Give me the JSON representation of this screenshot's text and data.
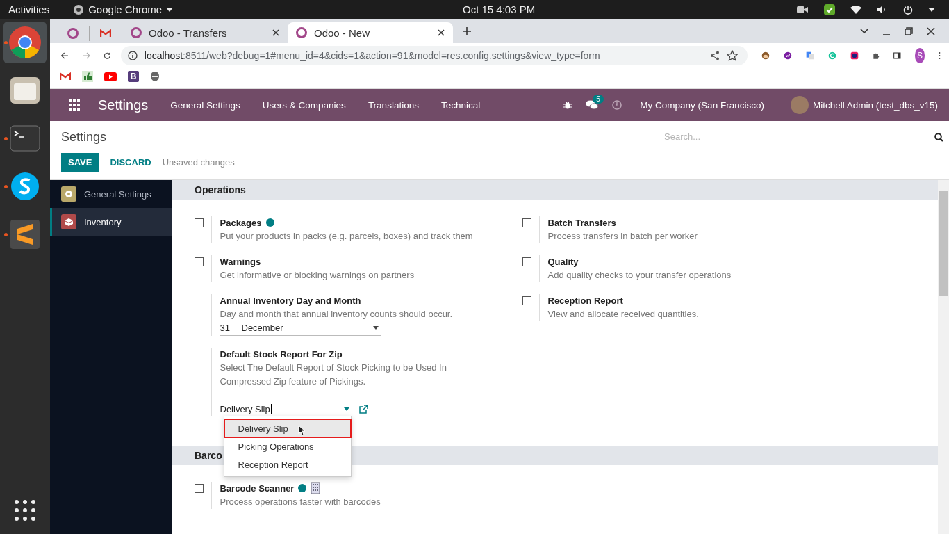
{
  "topbar": {
    "activities": "Activities",
    "app_name": "Google Chrome",
    "clock": "Oct 15  4:03 PM"
  },
  "dock": [
    {
      "kind": "browser",
      "running": true,
      "selected": true
    },
    {
      "kind": "files",
      "running": false,
      "selected": false
    },
    {
      "kind": "terminal",
      "running": true,
      "selected": false
    },
    {
      "kind": "chat",
      "running": true,
      "selected": false
    },
    {
      "kind": "editor",
      "running": true,
      "selected": false
    }
  ],
  "browser": {
    "tabs": [
      {
        "kind": "pinned-odoo",
        "selected": false
      },
      {
        "kind": "pinned-mail",
        "selected": false
      },
      {
        "kind": "odoo",
        "title": "Odoo - Transfers",
        "selected": false
      },
      {
        "kind": "odoo",
        "title": "Odoo - New",
        "selected": true
      }
    ],
    "url_host": "localhost",
    "url_rest": ":8511/web?debug=1#menu_id=4&cids=1&action=91&model=res.config.settings&view_type=form",
    "profile": "S",
    "bookmarks": [
      {
        "kind": "mail"
      },
      {
        "kind": "thumb"
      },
      {
        "kind": "video"
      },
      {
        "kind": "letter",
        "label": "B"
      },
      {
        "kind": "mask"
      }
    ]
  },
  "navbar": {
    "app": "Settings",
    "menu": [
      "General Settings",
      "Users & Companies",
      "Translations",
      "Technical"
    ],
    "messages_badge": "5",
    "company": "My Company (San Francisco)",
    "user": "Mitchell Admin (test_dbs_v15)"
  },
  "control_panel": {
    "title": "Settings",
    "save": "SAVE",
    "discard": "DISCARD",
    "status": "Unsaved changes",
    "search_placeholder": "Search..."
  },
  "sidebar": [
    {
      "kind": "general",
      "label": "General Settings",
      "selected": false
    },
    {
      "kind": "inventory",
      "label": "Inventory",
      "selected": true
    }
  ],
  "operations": {
    "title": "Operations",
    "left": [
      {
        "kind": "checkbox",
        "title": "Packages",
        "help": true,
        "checked": false,
        "description": "Put your products in packs (e.g. parcels, boxes) and track them"
      },
      {
        "kind": "checkbox",
        "title": "Warnings",
        "help": false,
        "checked": false,
        "description": "Get informative or blocking warnings on partners"
      },
      {
        "kind": "date",
        "title": "Annual Inventory Day and Month",
        "description": "Day and month that annual inventory counts should occur.",
        "day": "31",
        "month": "December"
      },
      {
        "kind": "select",
        "title": "Default Stock Report For Zip",
        "description": "Select The Default Report of Stock Picking to be Used In Compressed Zip feature of Pickings.",
        "value": "Delivery Slip",
        "options": [
          {
            "label": "Delivery Slip",
            "selected": true
          },
          {
            "label": "Picking Operations",
            "selected": false
          },
          {
            "label": "Reception Report",
            "selected": false
          }
        ]
      }
    ],
    "right": [
      {
        "kind": "checkbox",
        "title": "Batch Transfers",
        "help": false,
        "checked": false,
        "description": "Process transfers in batch per worker"
      },
      {
        "kind": "checkbox",
        "title": "Quality",
        "help": false,
        "checked": false,
        "description": "Add quality checks to your transfer operations"
      },
      {
        "kind": "checkbox",
        "title": "Reception Report",
        "help": false,
        "checked": false,
        "description": "View and allocate received quantities."
      }
    ]
  },
  "barcode": {
    "title": "Barco",
    "left": [
      {
        "kind": "checkbox",
        "title": "Barcode Scanner",
        "help": true,
        "checked": false,
        "description": "Process operations faster with barcodes"
      }
    ]
  }
}
